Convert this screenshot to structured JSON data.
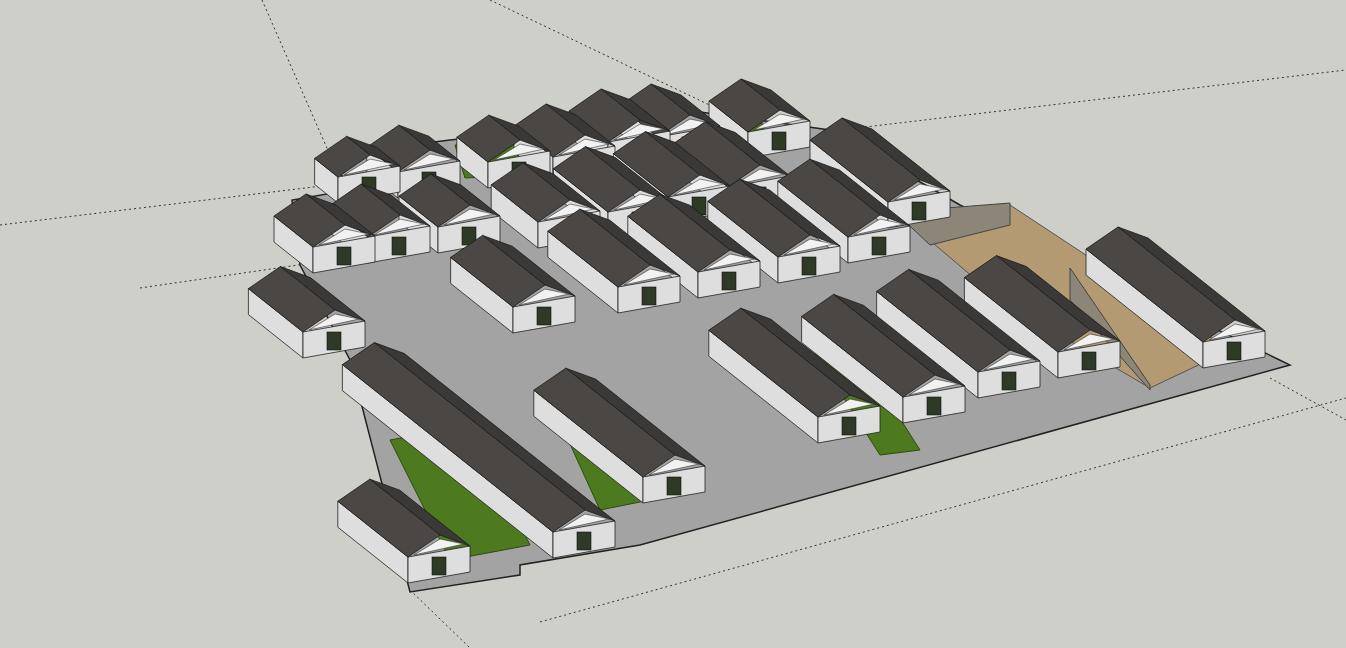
{
  "viewport": {
    "kind": "model",
    "axes_shown": true
  }
}
